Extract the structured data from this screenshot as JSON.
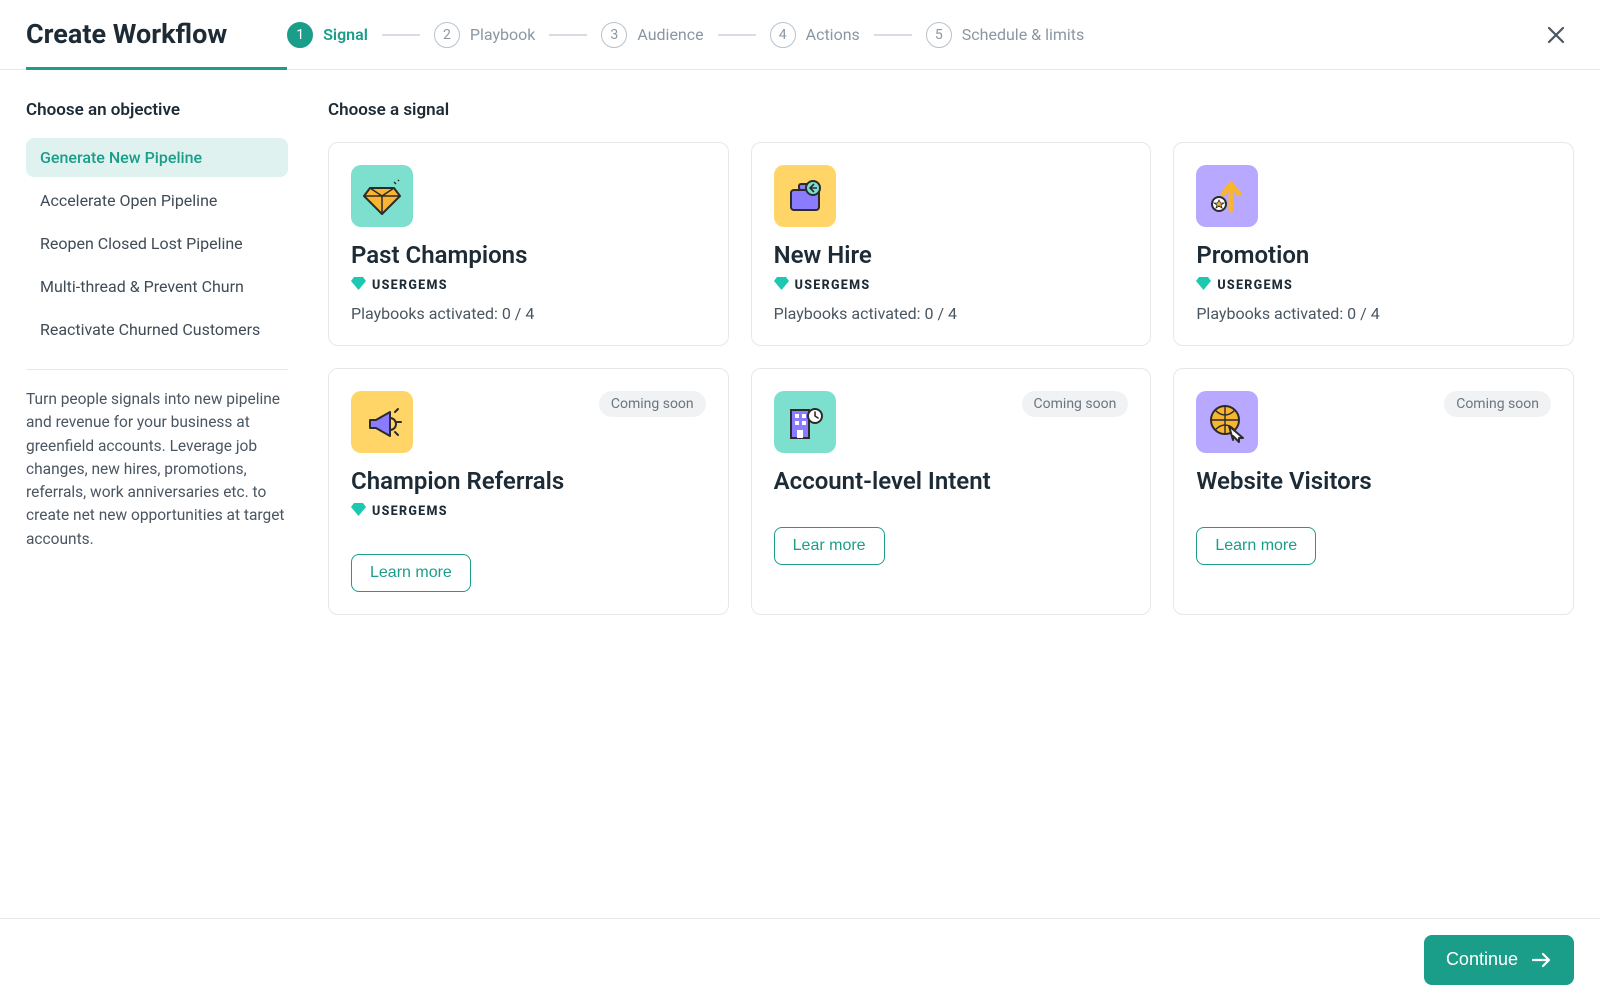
{
  "header": {
    "title": "Create Workflow",
    "steps": [
      {
        "num": "1",
        "label": "Signal",
        "active": true
      },
      {
        "num": "2",
        "label": "Playbook",
        "active": false
      },
      {
        "num": "3",
        "label": "Audience",
        "active": false
      },
      {
        "num": "4",
        "label": "Actions",
        "active": false
      },
      {
        "num": "5",
        "label": "Schedule & limits",
        "active": false
      }
    ]
  },
  "sidebar": {
    "heading": "Choose an objective",
    "items": [
      {
        "label": "Generate New Pipeline",
        "active": true
      },
      {
        "label": "Accelerate Open Pipeline",
        "active": false
      },
      {
        "label": "Reopen Closed Lost Pipeline",
        "active": false
      },
      {
        "label": "Multi-thread & Prevent Churn",
        "active": false
      },
      {
        "label": "Reactivate Churned Customers",
        "active": false
      }
    ],
    "description": "Turn people signals into new pipeline and revenue for your business at greenfield accounts. Leverage job changes, new hires, promotions, referrals, work anniversaries etc. to create net new opportunities at target accounts."
  },
  "main": {
    "heading": "Choose a signal",
    "usergems_label": "USERGEMS",
    "coming_soon_label": "Coming soon",
    "learn_more_label": "Learn more",
    "learn_more_label_alt": "Lear more",
    "cards": [
      {
        "title": "Past Champions",
        "playbooks": "Playbooks activated: 0 / 4",
        "usergems": true,
        "icon_bg": "#7de0cf",
        "icon": "diamond",
        "coming_soon": false,
        "learn_more": false
      },
      {
        "title": "New Hire",
        "playbooks": "Playbooks activated: 0 / 4",
        "usergems": true,
        "icon_bg": "#ffd568",
        "icon": "briefcase",
        "coming_soon": false,
        "learn_more": false
      },
      {
        "title": "Promotion",
        "playbooks": "Playbooks activated: 0 / 4",
        "usergems": true,
        "icon_bg": "#b8a8ff",
        "icon": "arrowup",
        "coming_soon": false,
        "learn_more": false
      },
      {
        "title": "Champion Referrals",
        "usergems": true,
        "icon_bg": "#ffd568",
        "icon": "megaphone",
        "coming_soon": true,
        "learn_more": true,
        "learn_key": "learn_more_label"
      },
      {
        "title": "Account-level Intent",
        "usergems": false,
        "icon_bg": "#7de0cf",
        "icon": "building",
        "coming_soon": true,
        "learn_more": true,
        "learn_key": "learn_more_label_alt"
      },
      {
        "title": "Website Visitors",
        "usergems": false,
        "icon_bg": "#b8a8ff",
        "icon": "globe",
        "coming_soon": true,
        "learn_more": true,
        "learn_key": "learn_more_label"
      }
    ]
  },
  "footer": {
    "continue_label": "Continue"
  }
}
